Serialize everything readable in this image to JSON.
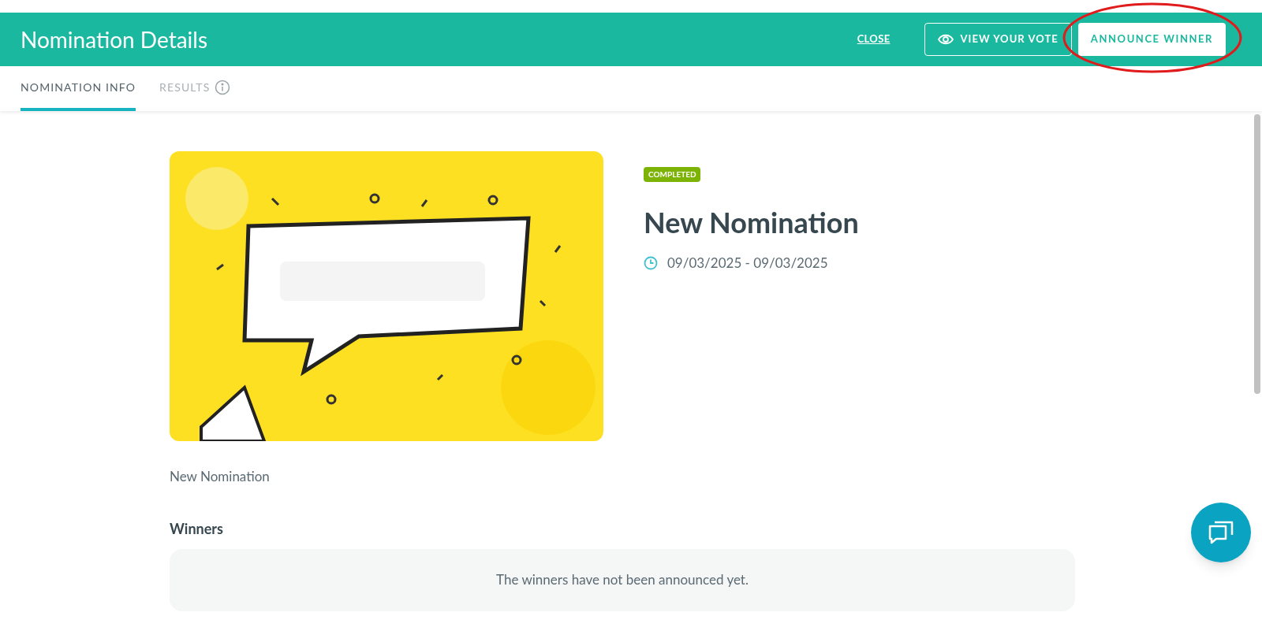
{
  "header": {
    "title": "Nomination Details",
    "close": "CLOSE",
    "view_vote": "VIEW YOUR VOTE",
    "announce": "ANNOUNCE WINNER"
  },
  "tabs": [
    {
      "label": "NOMINATION INFO",
      "selected": true,
      "info": false
    },
    {
      "label": "RESULTS",
      "selected": false,
      "info": true
    }
  ],
  "nomination": {
    "status": "COMPLETED",
    "title": "New Nomination",
    "dates": "09/03/2025 - 09/03/2025",
    "description": "New Nomination"
  },
  "winners": {
    "heading": "Winners",
    "message": "The winners have not been announced yet."
  }
}
